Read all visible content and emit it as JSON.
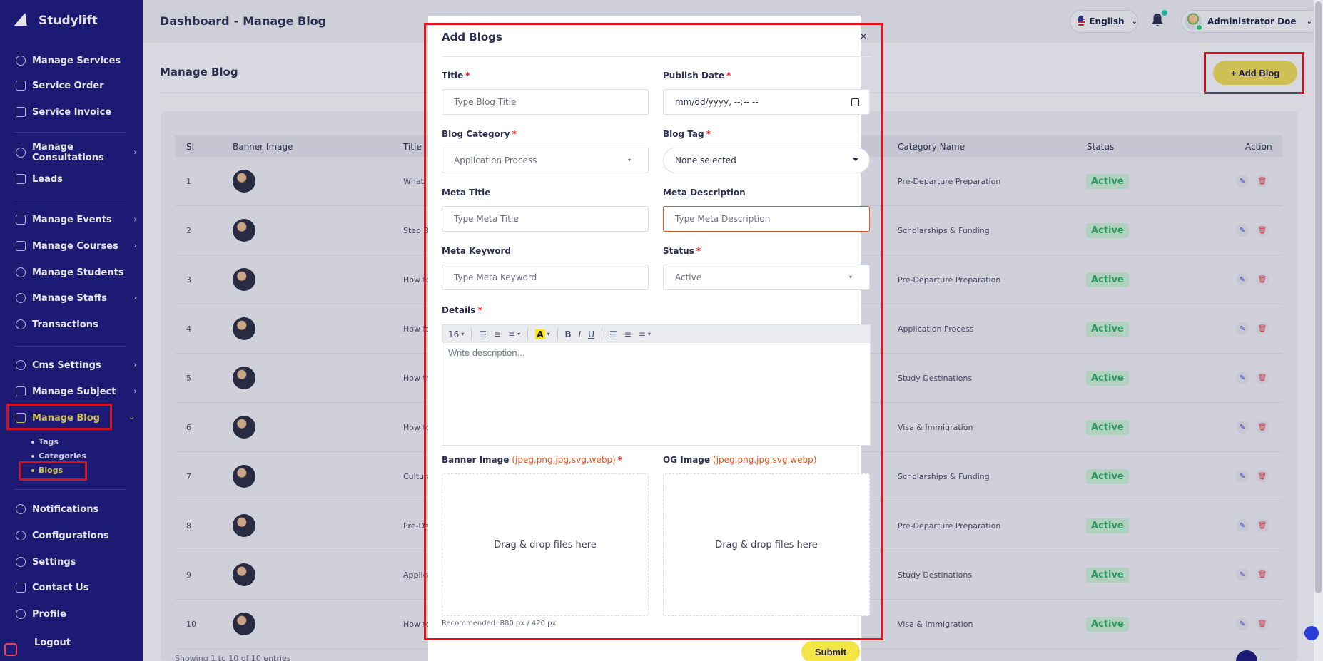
{
  "app": {
    "name": "Studylift"
  },
  "sidebar": {
    "items": [
      {
        "label": "Manage Services"
      },
      {
        "label": "Service Order"
      },
      {
        "label": "Service Invoice"
      },
      {
        "label": "Manage Consultations"
      },
      {
        "label": "Leads"
      },
      {
        "label": "Manage Events"
      },
      {
        "label": "Manage Courses"
      },
      {
        "label": "Manage Students"
      },
      {
        "label": "Manage Staffs"
      },
      {
        "label": "Transactions"
      },
      {
        "label": "Cms Settings"
      },
      {
        "label": "Manage Subject"
      },
      {
        "label": "Manage Blog"
      },
      {
        "label": "Notifications"
      },
      {
        "label": "Configurations"
      },
      {
        "label": "Settings"
      },
      {
        "label": "Contact Us"
      },
      {
        "label": "Profile"
      },
      {
        "label": "Logout"
      }
    ],
    "blog_sub": [
      {
        "label": "Tags"
      },
      {
        "label": "Categories"
      },
      {
        "label": "Blogs"
      }
    ]
  },
  "header": {
    "crumb_root": "Dashboard",
    "crumb_sep": "-",
    "crumb_current": "Manage Blog",
    "language": "English",
    "user_name": "Administrator Doe"
  },
  "main": {
    "title": "Manage Blog",
    "add_button": "+ Add Blog",
    "table": {
      "columns": [
        "Sl",
        "Banner Image",
        "Title",
        "Category Name",
        "Status",
        "Action"
      ],
      "rows": [
        {
          "sl": "1",
          "title": "What",
          "category": "Pre-Departure Preparation",
          "status": "Active"
        },
        {
          "sl": "2",
          "title": "Step B",
          "category": "Scholarships & Funding",
          "status": "Active"
        },
        {
          "sl": "3",
          "title": "How to",
          "category": "Pre-Departure Preparation",
          "status": "Active"
        },
        {
          "sl": "4",
          "title": "How lo",
          "category": "Application Process",
          "status": "Active"
        },
        {
          "sl": "5",
          "title": "How th",
          "category": "Study Destinations",
          "status": "Active"
        },
        {
          "sl": "6",
          "title": "How to",
          "category": "Visa & Immigration",
          "status": "Active"
        },
        {
          "sl": "7",
          "title": "Cultura",
          "category": "Scholarships & Funding",
          "status": "Active"
        },
        {
          "sl": "8",
          "title": "Pre-De",
          "category": "Pre-Departure Preparation",
          "status": "Active"
        },
        {
          "sl": "9",
          "title": "Applica",
          "category": "Study Destinations",
          "status": "Active"
        },
        {
          "sl": "10",
          "title": "How to",
          "category": "Visa & Immigration",
          "status": "Active"
        }
      ]
    },
    "showing": "Showing 1 to 10 of 10 entries"
  },
  "modal": {
    "title": "Add Blogs",
    "close": "×",
    "fields": {
      "title": {
        "label": "Title",
        "placeholder": "Type Blog Title"
      },
      "publish_date": {
        "label": "Publish Date",
        "value": "mm/dd/yyyy, --:-- --"
      },
      "category": {
        "label": "Blog Category",
        "value": "Application Process"
      },
      "tag": {
        "label": "Blog Tag",
        "value": "None selected"
      },
      "meta_title": {
        "label": "Meta Title",
        "placeholder": "Type Meta Title"
      },
      "meta_description": {
        "label": "Meta Description",
        "placeholder": "Type Meta Description"
      },
      "meta_keyword": {
        "label": "Meta Keyword",
        "placeholder": "Type Meta Keyword"
      },
      "status": {
        "label": "Status",
        "value": "Active"
      },
      "details": {
        "label": "Details",
        "placeholder": "Write description..."
      },
      "banner": {
        "label": "Banner Image",
        "hint": "(jpeg,png,jpg,svg,webp)"
      },
      "og": {
        "label": "OG Image",
        "hint": "(jpeg,png,jpg,svg,webp)"
      }
    },
    "required_mark": "*",
    "editor": {
      "font_size": "16"
    },
    "dropzone_text": "Drag & drop files here",
    "recommended": "Recommended: 880 px / 420 px",
    "submit": "Submit"
  },
  "colors": {
    "sidebar_bg": "#1c1a7c",
    "accent_yellow": "#e7d65a",
    "highlight_red": "#e8111b",
    "status_green": "#2fa866"
  }
}
